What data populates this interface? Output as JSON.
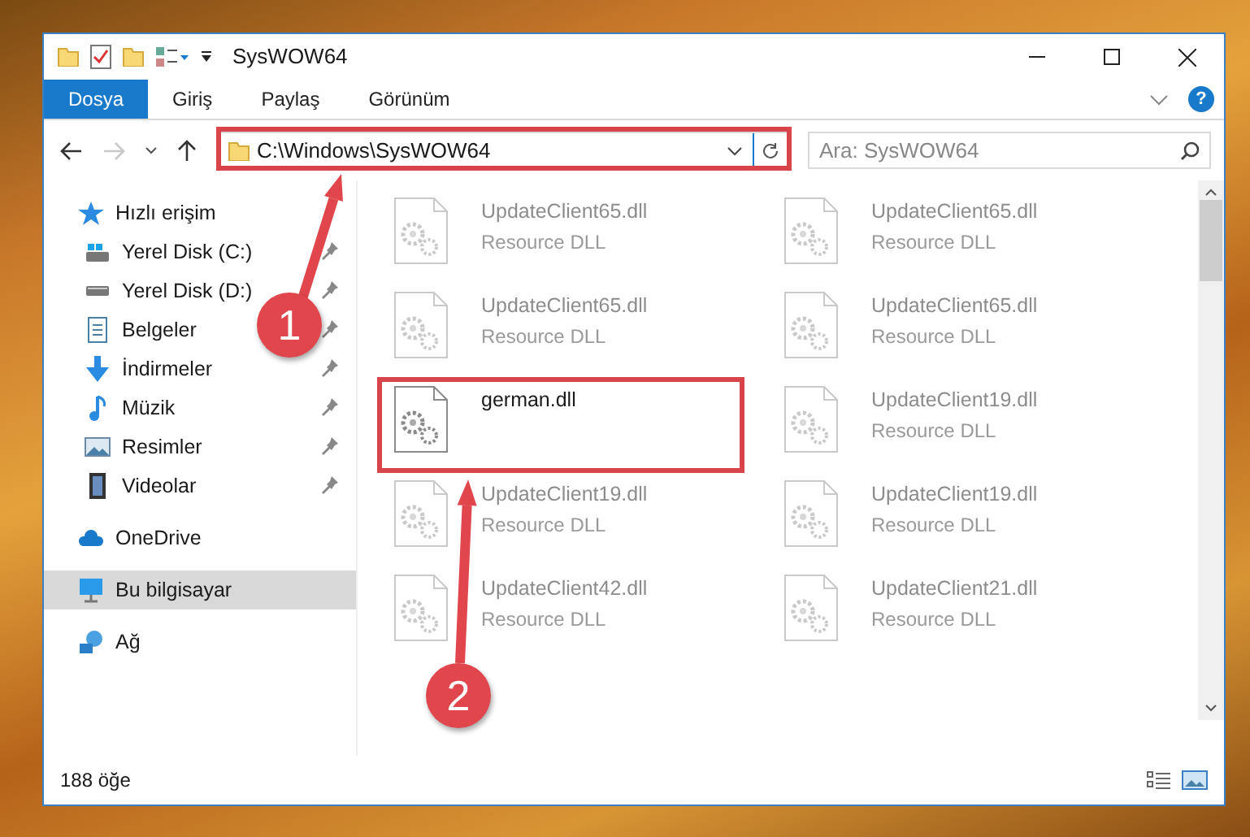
{
  "window": {
    "title": "SysWOW64"
  },
  "ribbon": {
    "tabs": [
      {
        "label": "Dosya",
        "kind": "file_menu"
      },
      {
        "label": "Giriş",
        "kind": "tab"
      },
      {
        "label": "Paylaş",
        "kind": "tab"
      },
      {
        "label": "Görünüm",
        "kind": "tab"
      }
    ],
    "help": "?"
  },
  "address_bar": {
    "path": "C:\\Windows\\SysWOW64",
    "search": {
      "placeholder": "Ara: SysWOW64"
    },
    "forward_disabled": true
  },
  "sidebar": {
    "items": [
      {
        "label": "Hızlı erişim",
        "selected": false,
        "children": [
          {
            "label": "Yerel Disk (C:)",
            "pinned": true,
            "selected": false
          },
          {
            "label": "Yerel Disk (D:)",
            "pinned": true,
            "selected": false
          },
          {
            "label": "Belgeler",
            "pinned": true,
            "selected": false
          },
          {
            "label": "İndirmeler",
            "pinned": true,
            "selected": false
          },
          {
            "label": "Müzik",
            "pinned": true,
            "selected": false
          },
          {
            "label": "Resimler",
            "pinned": true,
            "selected": false
          },
          {
            "label": "Videolar",
            "pinned": true,
            "selected": false
          }
        ]
      },
      {
        "label": "OneDrive",
        "selected": false
      },
      {
        "label": "Bu bilgisayar",
        "selected": true
      },
      {
        "label": "Ağ",
        "selected": false
      }
    ]
  },
  "files": [
    {
      "name": "UpdateClient65.dll",
      "type": "Resource DLL",
      "dimmed": true
    },
    {
      "name": "UpdateClient65.dll",
      "type": "Resource DLL",
      "dimmed": true
    },
    {
      "name": "UpdateClient65.dll",
      "type": "Resource DLL",
      "dimmed": true
    },
    {
      "name": "UpdateClient65.dll",
      "type": "Resource DLL",
      "dimmed": true
    },
    {
      "name": "german.dll",
      "dimmed": false,
      "highlighted": true
    },
    {
      "name": "UpdateClient19.dll",
      "type": "Resource DLL",
      "dimmed": true
    },
    {
      "name": "UpdateClient19.dll",
      "type": "Resource DLL",
      "dimmed": true
    },
    {
      "name": "UpdateClient19.dll",
      "type": "Resource DLL",
      "dimmed": true
    },
    {
      "name": "UpdateClient42.dll",
      "type": "Resource DLL",
      "dimmed": true
    },
    {
      "name": "UpdateClient21.dll",
      "type": "Resource DLL",
      "dimmed": true
    }
  ],
  "status_bar": {
    "count": "188 öğe"
  },
  "annotations": [
    {
      "label": "1"
    },
    {
      "label": "2"
    }
  ]
}
